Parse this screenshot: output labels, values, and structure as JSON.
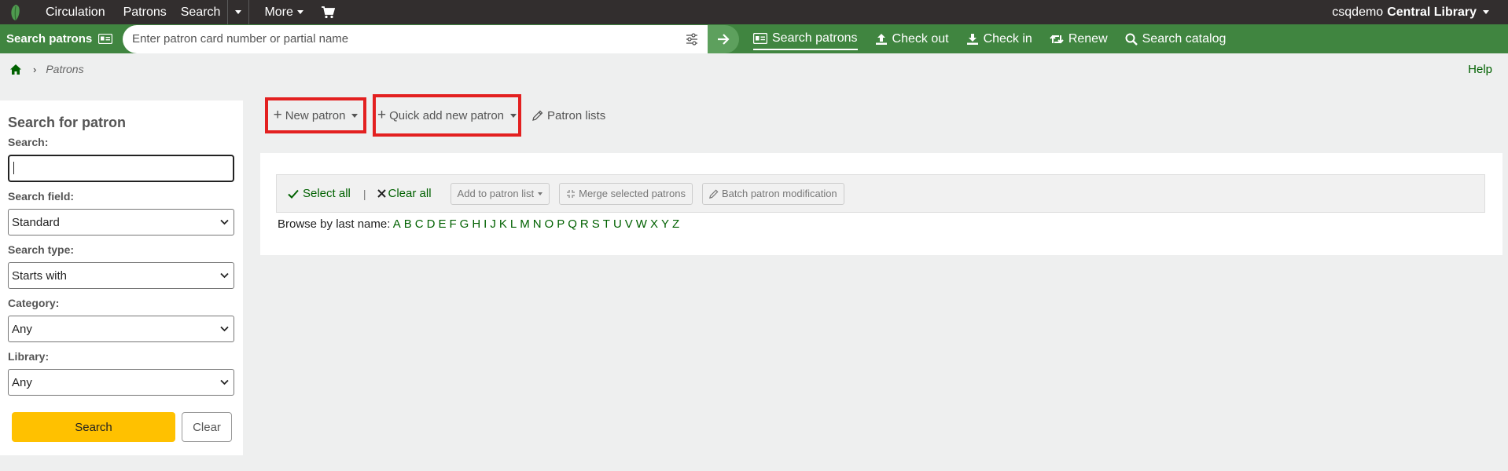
{
  "topnav": {
    "items": [
      "Circulation",
      "Patrons",
      "Search",
      "More"
    ],
    "user": "csqdemo",
    "library": "Central Library"
  },
  "searchbar": {
    "label": "Search patrons",
    "placeholder": "Enter patron card number or partial name",
    "links": [
      "Search patrons",
      "Check out",
      "Check in",
      "Renew",
      "Search catalog"
    ]
  },
  "breadcrumb": {
    "current": "Patrons"
  },
  "help": "Help",
  "sidebar": {
    "title": "Search for patron",
    "search_label": "Search:",
    "search_value": "",
    "field_label": "Search field:",
    "field_value": "Standard",
    "type_label": "Search type:",
    "type_value": "Starts with",
    "category_label": "Category:",
    "category_value": "Any",
    "library_label": "Library:",
    "library_value": "Any",
    "search_button": "Search",
    "clear_button": "Clear"
  },
  "toolbar": {
    "new_patron": "New patron",
    "quick_add": "Quick add new patron",
    "patron_lists": "Patron lists"
  },
  "actions": {
    "select_all": "Select all",
    "clear_all": "Clear all",
    "add_to_list": "Add to patron list",
    "merge": "Merge selected patrons",
    "batch": "Batch patron modification"
  },
  "browse": {
    "label": "Browse by last name:",
    "letters": [
      "A",
      "B",
      "C",
      "D",
      "E",
      "F",
      "G",
      "H",
      "I",
      "J",
      "K",
      "L",
      "M",
      "N",
      "O",
      "P",
      "Q",
      "R",
      "S",
      "T",
      "U",
      "V",
      "W",
      "X",
      "Y",
      "Z"
    ]
  },
  "colors": {
    "topbar": "#322e2e",
    "green": "#408540",
    "link": "#006100",
    "search_button": "#ffc100",
    "highlight": "#e32020"
  }
}
